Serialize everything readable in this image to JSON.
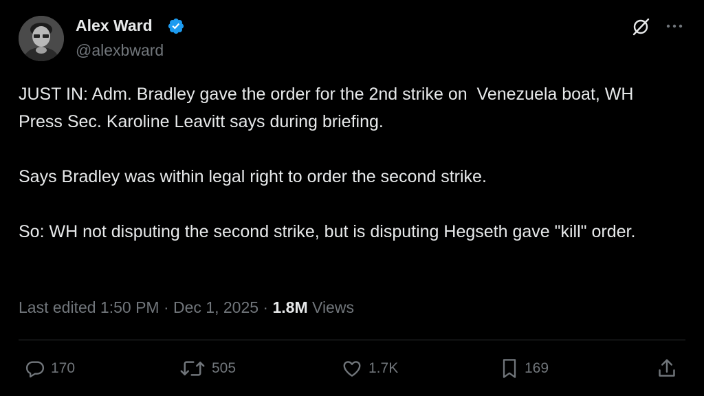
{
  "author": {
    "display_name": "Alex Ward",
    "handle": "@alexbward",
    "verified": true
  },
  "tweet": {
    "paragraphs": [
      "JUST IN: Adm. Bradley gave the order for the 2nd strike on  Venezuela boat, WH Press Sec. Karoline Leavitt says during briefing.",
      "Says Bradley was within legal right to order the second strike.",
      "So: WH not disputing the second strike, but is disputing Hegseth gave \"kill\" order."
    ],
    "meta_prefix": "Last edited 1:50 PM · Dec 1, 2025 · ",
    "views_count": "1.8M",
    "views_label": " Views"
  },
  "actions": {
    "replies": "170",
    "reposts": "505",
    "likes": "1.7K",
    "bookmarks": "169"
  },
  "icons": {
    "verified": "verified-badge-icon",
    "grok": "grok-icon",
    "more": "more-icon",
    "reply": "reply-icon",
    "repost": "repost-icon",
    "like": "heart-icon",
    "bookmark": "bookmark-icon",
    "share": "share-icon"
  },
  "colors": {
    "background": "#000000",
    "text": "#e7e9ea",
    "secondary": "#71767b",
    "verified": "#1d9bf0",
    "divider": "#2f3336"
  }
}
